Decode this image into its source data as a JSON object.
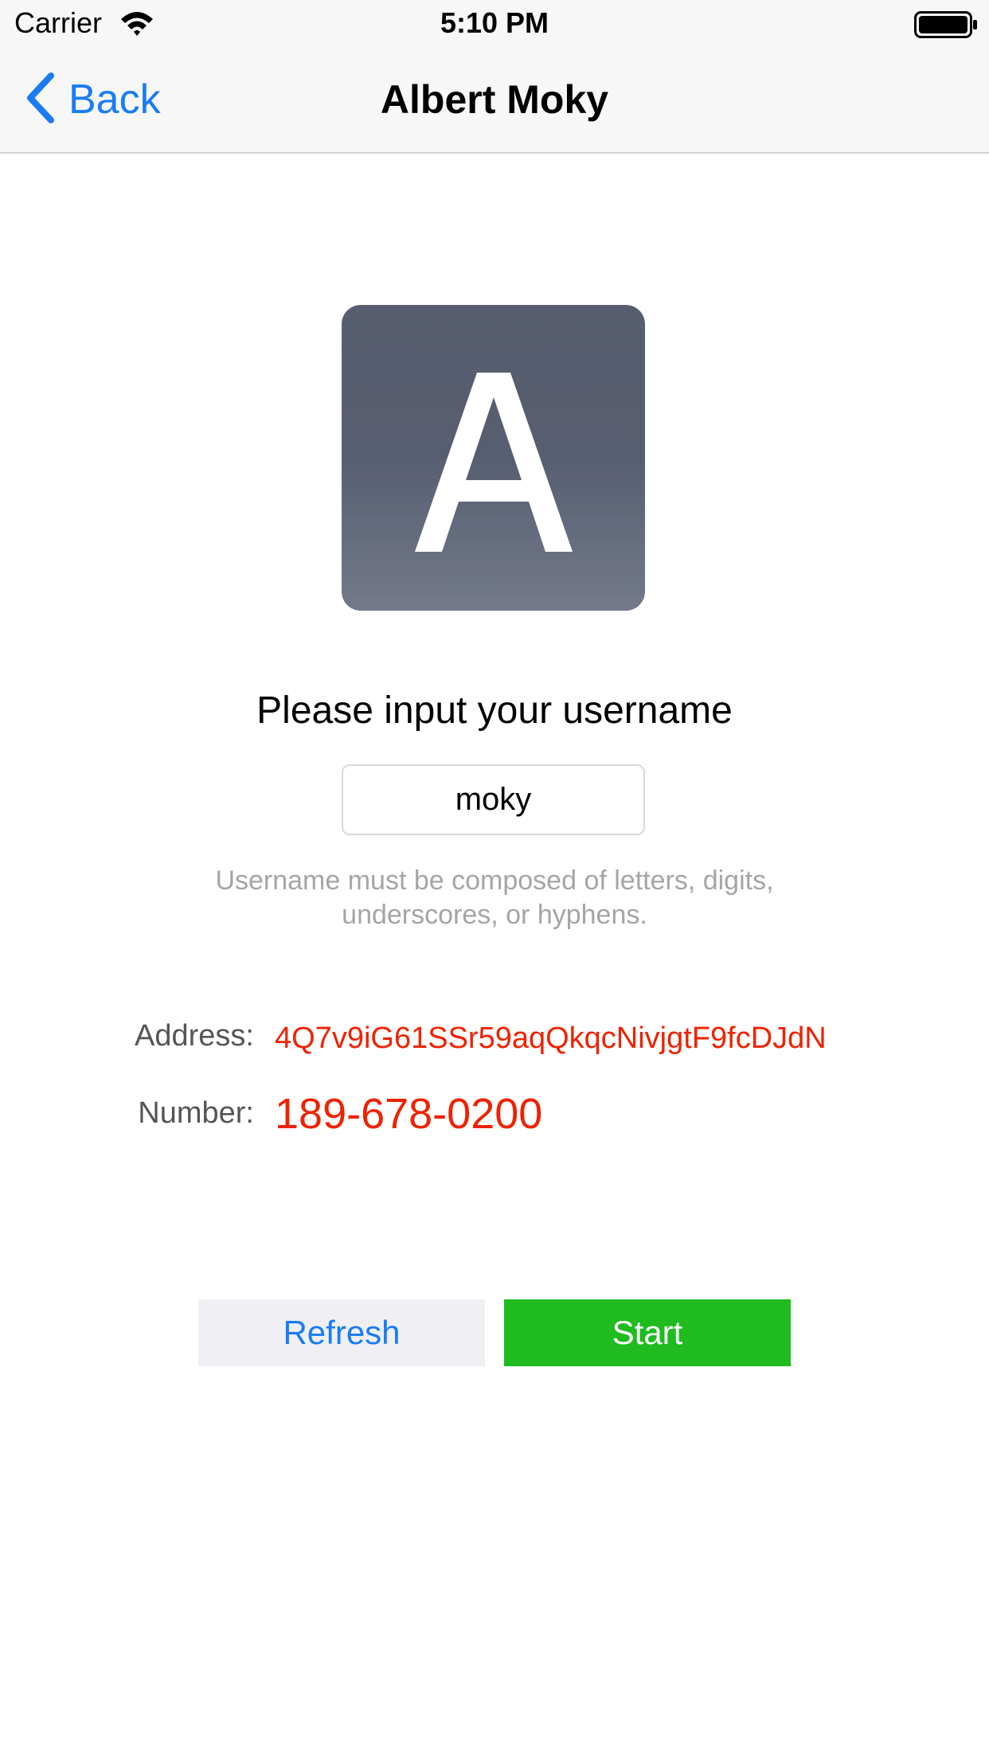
{
  "status_bar": {
    "carrier": "Carrier",
    "time": "5:10 PM",
    "icons": [
      "wifi-icon",
      "battery-icon"
    ]
  },
  "nav": {
    "back_label": "Back",
    "title": "Albert Moky",
    "back_icon": "chevron-left-icon"
  },
  "avatar": {
    "letter": "A",
    "background": "#555b6e",
    "letter_color": "#ffffff"
  },
  "form": {
    "prompt": "Please input your username",
    "username_value": "moky",
    "hint": "Username must be composed of letters, digits, underscores, or hyphens."
  },
  "info": {
    "address_label": "Address:",
    "address_value": "4Q7v9iG61SSr59aqQkqcNivjgtF9fcDJdN",
    "number_label": "Number:",
    "number_value": "189-678-0200"
  },
  "actions": {
    "refresh_label": "Refresh",
    "start_label": "Start"
  },
  "colors": {
    "accent": "#1a7cf5",
    "highlight": "#ee2200",
    "start_button": "#1fbb1f",
    "refresh_button": "#efeff4"
  }
}
